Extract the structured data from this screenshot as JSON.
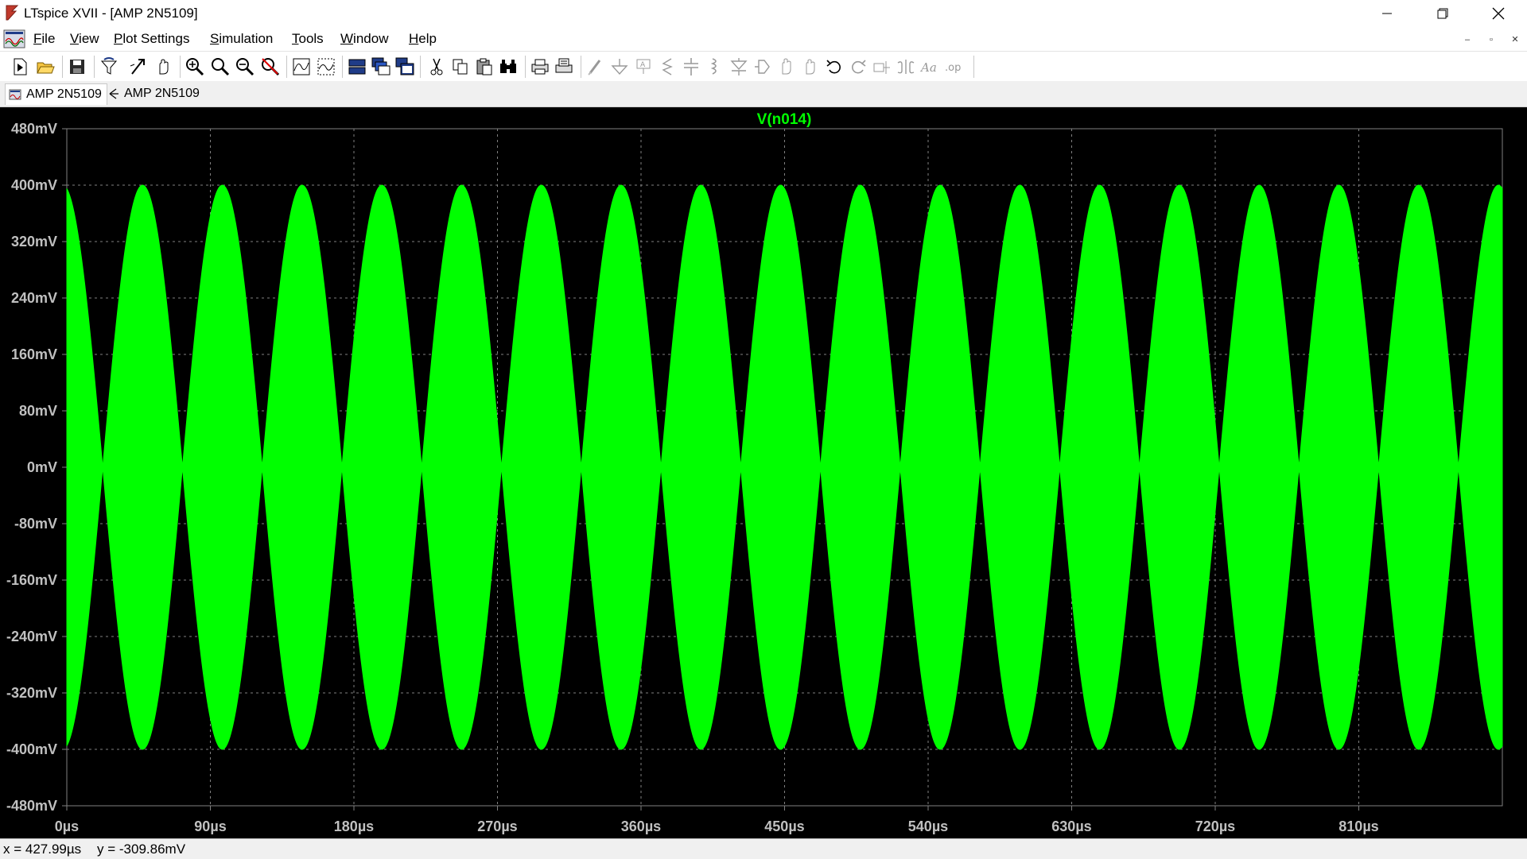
{
  "window": {
    "title": "LTspice XVII - [AMP 2N5109]",
    "controls": {
      "minimize": "–",
      "restore": "❐",
      "close": "✕"
    }
  },
  "menu": {
    "items": [
      {
        "label": "File",
        "mnemonic": "F"
      },
      {
        "label": "View",
        "mnemonic": "V"
      },
      {
        "label": "Plot Settings",
        "mnemonic": "P"
      },
      {
        "label": "Simulation",
        "mnemonic": "S"
      },
      {
        "label": "Tools",
        "mnemonic": "T"
      },
      {
        "label": "Window",
        "mnemonic": "W"
      },
      {
        "label": "Help",
        "mnemonic": "H"
      }
    ],
    "mdi_controls": {
      "minimize": "–",
      "restore": "▫",
      "close": "✕"
    }
  },
  "toolbar": {
    "icons": [
      "new-schematic-icon",
      "open-icon",
      "save-icon",
      "control-panel-icon",
      "run-icon",
      "halt-icon",
      "zoom-in-icon",
      "zoom-full-icon",
      "zoom-out-icon",
      "zoom-cancel-icon",
      "autorange-icon",
      "plot-pane-icon",
      "tile-horizontal-icon",
      "cascade-icon",
      "tile-vertical-icon",
      "cut-icon",
      "copy-icon",
      "paste-icon",
      "find-icon",
      "print-icon",
      "print-setup-icon",
      "wire-icon",
      "ground-icon",
      "label-icon",
      "resistor-icon",
      "capacitor-icon",
      "inductor-icon",
      "diode-icon",
      "component-icon",
      "move-icon",
      "drag-icon",
      "undo-icon",
      "redo-icon",
      "rotate-icon",
      "mirror-icon",
      "text-icon",
      "spice-directive-icon"
    ]
  },
  "tabs": [
    {
      "label": "AMP 2N5109",
      "icon": "waveform-icon",
      "active": true
    },
    {
      "label": "AMP 2N5109",
      "icon": "schematic-icon",
      "active": false
    }
  ],
  "status": {
    "x_readout": "x = 427.99µs",
    "y_readout": "y = -309.86mV"
  },
  "colors": {
    "trace": "#00ff00",
    "plot_bg": "#000000",
    "grid": "#808080",
    "axis_label": "#c0c0c0"
  },
  "chart_data": {
    "type": "line",
    "title": "V(n014)",
    "series": [
      {
        "name": "V(n014)",
        "description_values": "AM-modulated carrier envelope",
        "envelope_peak_mV": 400,
        "cycles_in_view": 18,
        "envelope_period_us": 50
      }
    ],
    "xlim": [
      0,
      900
    ],
    "ylim": [
      -480,
      480
    ],
    "x_ticks": [
      "0µs",
      "90µs",
      "180µs",
      "270µs",
      "360µs",
      "450µs",
      "540µs",
      "630µs",
      "720µs",
      "810µs"
    ],
    "x_tick_values": [
      0,
      90,
      180,
      270,
      360,
      450,
      540,
      630,
      720,
      810
    ],
    "y_ticks": [
      "480mV",
      "400mV",
      "320mV",
      "240mV",
      "160mV",
      "80mV",
      "0mV",
      "-80mV",
      "-160mV",
      "-240mV",
      "-320mV",
      "-400mV",
      "-480mV"
    ],
    "y_tick_values": [
      480,
      400,
      320,
      240,
      160,
      80,
      0,
      -80,
      -160,
      -240,
      -320,
      -400,
      -480
    ],
    "grid": true
  }
}
